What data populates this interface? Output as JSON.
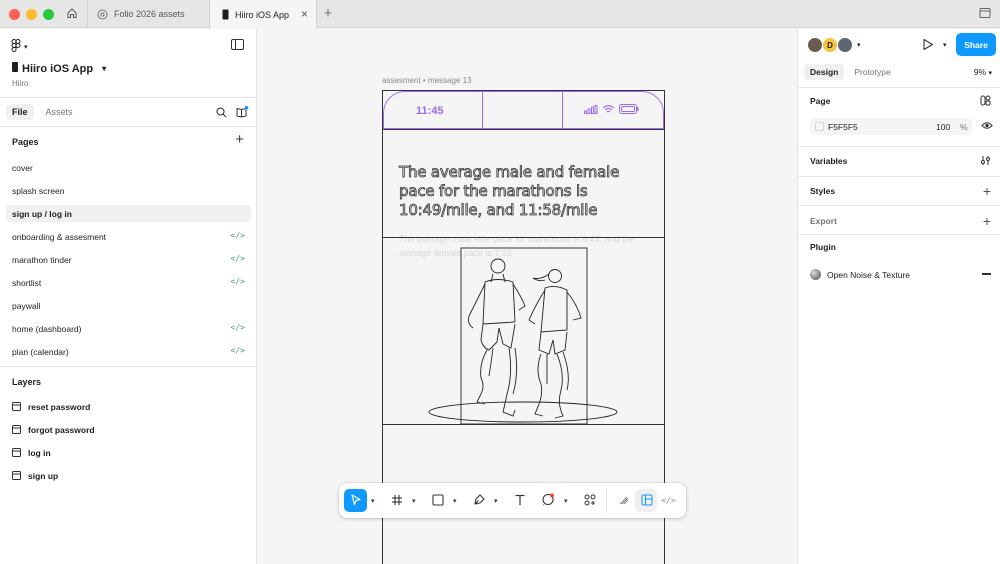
{
  "titlebar": {
    "tabs": [
      {
        "label": "Folio 2026 assets",
        "active": false
      },
      {
        "label": "Hiiro iOS App",
        "active": true
      }
    ],
    "new_tab_label": "+"
  },
  "left_panel": {
    "project_title": "Hiiro iOS App",
    "project_subtitle": "Hiiro",
    "tabs": [
      {
        "label": "File",
        "active": true
      },
      {
        "label": "Assets",
        "active": false
      }
    ],
    "pages_heading": "Pages",
    "pages": [
      {
        "label": "cover",
        "code": ""
      },
      {
        "label": "splash screen",
        "code": ""
      },
      {
        "label": "sign up / log in",
        "code": "",
        "selected": true
      },
      {
        "label": "onboarding & assesment",
        "code": "</>"
      },
      {
        "label": "marathon tinder",
        "code": "</>"
      },
      {
        "label": "shortlist",
        "code": "</>"
      },
      {
        "label": "paywall",
        "code": ""
      },
      {
        "label": "home (dashboard)",
        "code": "</>"
      },
      {
        "label": "plan (calendar)",
        "code": "</>"
      }
    ],
    "layers_heading": "Layers",
    "layers": [
      {
        "label": "reset password"
      },
      {
        "label": "forgot password"
      },
      {
        "label": "log in"
      },
      {
        "label": "sign up"
      }
    ]
  },
  "canvas": {
    "frame_label": "assesment • message 13",
    "status_time": "11:45",
    "headline": "The average male and female pace for the marathons is 10:49/mile, and 11:58/mile",
    "ghost_text": "The average male elite pace for marathons is 6:43, and the average female pace is 7:28"
  },
  "toolbar": {
    "tools": [
      "move-tool",
      "frame-tool",
      "shape-tool",
      "pen-tool",
      "text-tool",
      "comment-tool",
      "actions-tool"
    ],
    "active_tool": "move-tool"
  },
  "right_panel": {
    "avatar_initial": "D",
    "share_label": "Share",
    "tabs": [
      {
        "label": "Design",
        "active": true
      },
      {
        "label": "Prototype",
        "active": false
      }
    ],
    "zoom": "9%",
    "page_heading": "Page",
    "page_color": "F5F5F5",
    "page_opacity": "100",
    "page_opacity_unit": "%",
    "variables_heading": "Variables",
    "styles_heading": "Styles",
    "export_heading": "Export",
    "plugin_heading": "Plugin",
    "plugin_name": "Open Noise & Texture"
  },
  "colors": {
    "accent": "#0d99ff",
    "frame_purple": "#9b6cf0",
    "dev_green": "#45a065"
  }
}
